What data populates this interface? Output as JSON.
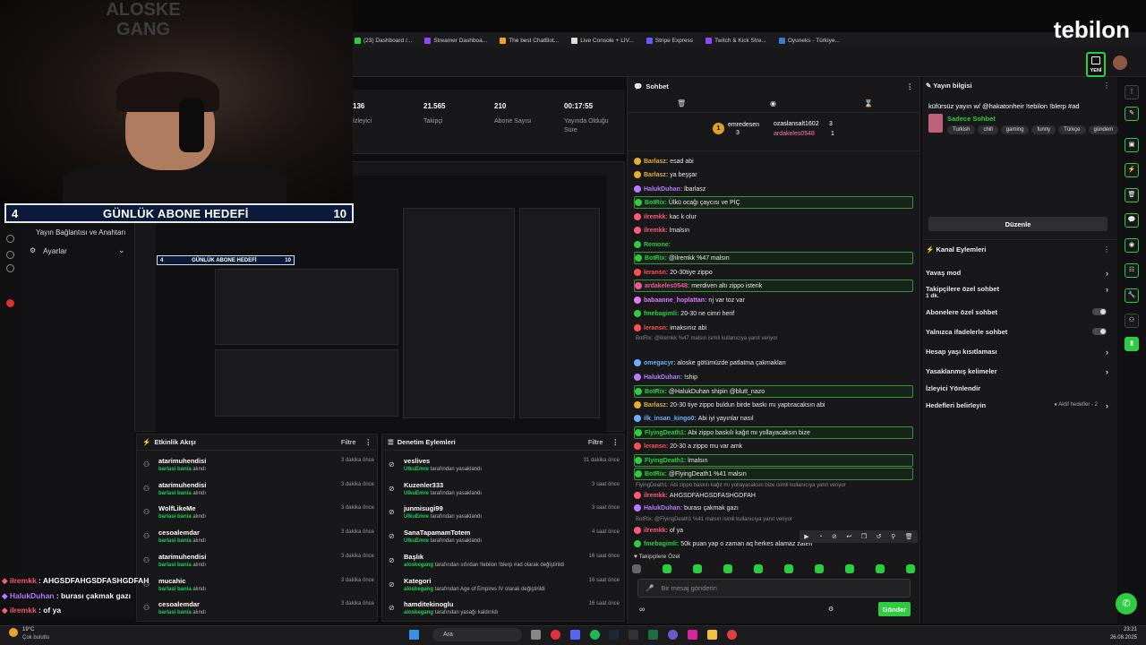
{
  "brand": {
    "logo": "tebilon"
  },
  "bookmarks": [
    "(23) Dashboard /...",
    "Streamer Dashboa...",
    "The best ChatBot...",
    "Live Console + LIV...",
    "Stripe Express",
    "Twitch & Kick Stre...",
    "Oyuneks - Türkiye..."
  ],
  "header": {
    "new_badge": "YENİ"
  },
  "webcam": {
    "watermark_line1": "ALOSKE",
    "watermark_line2": "GANG"
  },
  "goal": {
    "current": "4",
    "title": "GÜNLÜK ABONE HEDEFİ",
    "target": "10"
  },
  "left_panel": {
    "title": "Yayın Bağlantısı ve Anahtarı",
    "settings": "Ayarlar"
  },
  "stats": [
    {
      "value": "136",
      "label": "İzleyici"
    },
    {
      "value": "21.565",
      "label": "Takipçi"
    },
    {
      "value": "210",
      "label": "Abone Sayısı"
    },
    {
      "value": "00:17:55",
      "label": "Yayında Olduğu Süre"
    }
  ],
  "activity": {
    "title": "Etkinlik Akışı",
    "filter": "Filtre",
    "items": [
      {
        "name": "atarimuhendisi",
        "who": "barlasi bania",
        "action": "alındı",
        "time": "3 dakika önce"
      },
      {
        "name": "atarimuhendisi",
        "who": "barlasi bania",
        "action": "alındı",
        "time": "3 dakika önce"
      },
      {
        "name": "WolfLikeMe",
        "who": "barlasi bania",
        "action": "alındı",
        "time": "3 dakika önce"
      },
      {
        "name": "cesoalemdar",
        "who": "barlasi bania",
        "action": "alındı",
        "time": "3 dakika önce"
      },
      {
        "name": "atarimuhendisi",
        "who": "barlasi bania",
        "action": "alındı",
        "time": "3 dakika önce"
      },
      {
        "name": "mucahic",
        "who": "barlasi bania",
        "action": "alındı",
        "time": "3 dakika önce"
      },
      {
        "name": "cesoalemdar",
        "who": "barlasi bania",
        "action": "alındı",
        "time": "3 dakika önce"
      }
    ]
  },
  "moderation": {
    "title": "Denetim Eylemleri",
    "filter": "Filtre",
    "items": [
      {
        "name": "veslives",
        "who": "UlkuEmre",
        "action": "tarafından yasaklandı",
        "time": "31 dakika önce"
      },
      {
        "name": "Kuzenler333",
        "who": "UlkuEmre",
        "action": "tarafından yasaklandı",
        "time": "3 saat önce"
      },
      {
        "name": "junmisugi99",
        "who": "UlkuEmre",
        "action": "tarafından yasaklandı",
        "time": "3 saat önce"
      },
      {
        "name": "SanaTapamamTotem",
        "who": "UlkuEmre",
        "action": "tarafından yasaklandı",
        "time": "4 saat önce"
      },
      {
        "name": "Başlık",
        "who": "aloskegang",
        "action": "tarafından sıfırdan !tebilon !blerp #ad olarak değiştirildi",
        "time": "16 saat önce"
      },
      {
        "name": "Kategori",
        "who": "aloskegang",
        "action": "tarafından Age of Empires IV olarak değiştirildi",
        "time": "16 saat önce"
      },
      {
        "name": "hamditekinoglu",
        "who": "aloskegang",
        "action": "tarafından yasağı kaldırıldı",
        "time": "16 saat önce"
      }
    ]
  },
  "chat": {
    "title": "Sohbet",
    "pinned": {
      "u1": "emredesen",
      "c1": "3",
      "u2": "ozaslansalt1602",
      "c2": "3",
      "u3": "ardakeles0548",
      "c3": "1"
    },
    "messages": [
      {
        "u": "Barlasz",
        "t": "esad abi",
        "c": "#e0b030",
        "hl": false
      },
      {
        "u": "Barlasz",
        "t": "ya beşşar",
        "c": "#e0b030",
        "hl": false
      },
      {
        "u": "HalukDuhan",
        "t": "lbarlasz",
        "c": "#b77bff",
        "hl": false
      },
      {
        "u": "BotRix",
        "t": "Ülkü ocağı çaycısı ve PİÇ",
        "c": "#2ecc40",
        "hl": true
      },
      {
        "u": "ilremkk",
        "t": "kac k olur",
        "c": "#ff5a7a",
        "hl": false
      },
      {
        "u": "ilremkk",
        "t": "lmalsın",
        "c": "#ff5a7a",
        "hl": false
      },
      {
        "u": "Remone",
        "t": "",
        "c": "#2ecc40",
        "hl": false
      },
      {
        "u": "BotRix",
        "t": "@ilremkk %47 malsın",
        "c": "#2ecc40",
        "hl": true
      },
      {
        "u": "leransn",
        "t": "20-30tiye zippo",
        "c": "#ff5050",
        "hl": false
      },
      {
        "u": "ardakeles0548",
        "t": "merdiven altı zippo isterik",
        "c": "#ff4fa0",
        "hl": true
      },
      {
        "u": "babaanne_hoplattan",
        "t": "rıj var toz var",
        "c": "#e07aff",
        "hl": false
      },
      {
        "u": "fmebagimli",
        "t": "20-30 ne cimri herif",
        "c": "#2ecc40",
        "hl": false
      },
      {
        "u": "leransn",
        "t": "imaksınız abi",
        "c": "#ff5050",
        "hl": false
      },
      {
        "u": "omegacyr",
        "t": "aloske götümüzde patlatma çakmakları",
        "c": "#6ab0ff",
        "hl": false
      },
      {
        "u": "HalukDuhan",
        "t": "!ship",
        "c": "#b77bff",
        "hl": false
      },
      {
        "u": "BotRix",
        "t": "@HalukDuhan shipin @blutt_nazo",
        "c": "#2ecc40",
        "hl": true
      },
      {
        "u": "Barlasz",
        "t": "20-30 tiye zippo buldun birde baskı mı yaptıracaksın abi",
        "c": "#e0b030",
        "hl": false
      },
      {
        "u": "ilk_insan_kingo0",
        "t": "Abi iyi yayınlar nasıl",
        "c": "#6ab0ff",
        "hl": false
      },
      {
        "u": "FlyingDeath1",
        "t": "Abi zippo baskılı kağıt mı yollayacaksın bize",
        "c": "#2ecc40",
        "hl": true
      },
      {
        "u": "leransn",
        "t": "20-30 a zippo mu var amk",
        "c": "#ff5050",
        "hl": false
      },
      {
        "u": "FlyingDeath1",
        "t": "lmalsın",
        "c": "#2ecc40",
        "hl": true
      },
      {
        "u": "BotRix",
        "t": "@FlyingDeath1 %41 malsın",
        "c": "#2ecc40",
        "hl": true
      },
      {
        "u": "ilremkk",
        "t": "AHGSDFAHGSDFASHGDFAH",
        "c": "#ff5a7a",
        "hl": false
      },
      {
        "u": "HalukDuhan",
        "t": "burası çakmak gazı",
        "c": "#b77bff",
        "hl": false
      },
      {
        "u": "ilremkk",
        "t": "of ya",
        "c": "#ff5a7a",
        "hl": false
      },
      {
        "u": "fmebagimli",
        "t": "50k puan yap o zaman aq herkes alamaz zaten",
        "c": "#2ecc40",
        "hl": false
      }
    ],
    "sys1": "BotRix: @ilremkk %47 malsın isimli kullanıcıya yanıt veriyor",
    "sys2": "FlyingDeath1: Abi zippo baskılı kağıt mı yollayacaksın bize isimli kullanıcıya yanıt veriyor",
    "sys3": "BotRix: @FlyingDeath1 %41 malsın isimli kullanıcıya yanıt veriyor",
    "followers_only": "Takipçilere Özel",
    "placeholder": "Bir mesaj gönderin",
    "send": "Gönder"
  },
  "stream_info": {
    "title": "Yayın bilgisi",
    "stream_title": "küfürsüz yayın w/ @hakatonheir !tebilon !blerp #ad",
    "category": "Sadece Sohbet",
    "tags": [
      "Turkish",
      "chill",
      "gaming",
      "funny",
      "Türkçe",
      "gündem"
    ],
    "edit": "Düzenle"
  },
  "channel_actions": {
    "title": "Kanal Eylemleri",
    "items": [
      {
        "label": "Yavaş mod",
        "kind": "chevron"
      },
      {
        "label": "Takipçilere özel sohbet",
        "sub": "1 dk.",
        "kind": "chevron"
      },
      {
        "label": "Abonelere özel sohbet",
        "kind": "toggle"
      },
      {
        "label": "Yalnızca ifadelerle sohbet",
        "kind": "toggle"
      },
      {
        "label": "Hesap yaşı kısıtlaması",
        "kind": "chevron"
      },
      {
        "label": "Yasaklanmış kelimeler",
        "kind": "chevron"
      },
      {
        "label": "İzleyici Yönlendir",
        "kind": "none"
      },
      {
        "label": "Hedefleri belirleyin",
        "extra": "Aktif hedefler - 2",
        "kind": "chevron"
      }
    ]
  },
  "overlay_chat": [
    {
      "u": "ilremkk",
      "t": "AHGSDFAHGSDFASHGDFAH",
      "c": "#ff5a7a"
    },
    {
      "u": "HalukDuhan",
      "t": "burası çakmak gazı",
      "c": "#b77bff"
    },
    {
      "u": "ilremkk",
      "t": "of ya",
      "c": "#ff5a7a"
    }
  ],
  "taskbar": {
    "weather_temp": "19°C",
    "weather_text": "Çok bulutlu",
    "search": "Ara",
    "time": "23:21",
    "date": "26.08.2025"
  },
  "colors": {
    "accent": "#2ecc40",
    "bg": "#18181b"
  }
}
